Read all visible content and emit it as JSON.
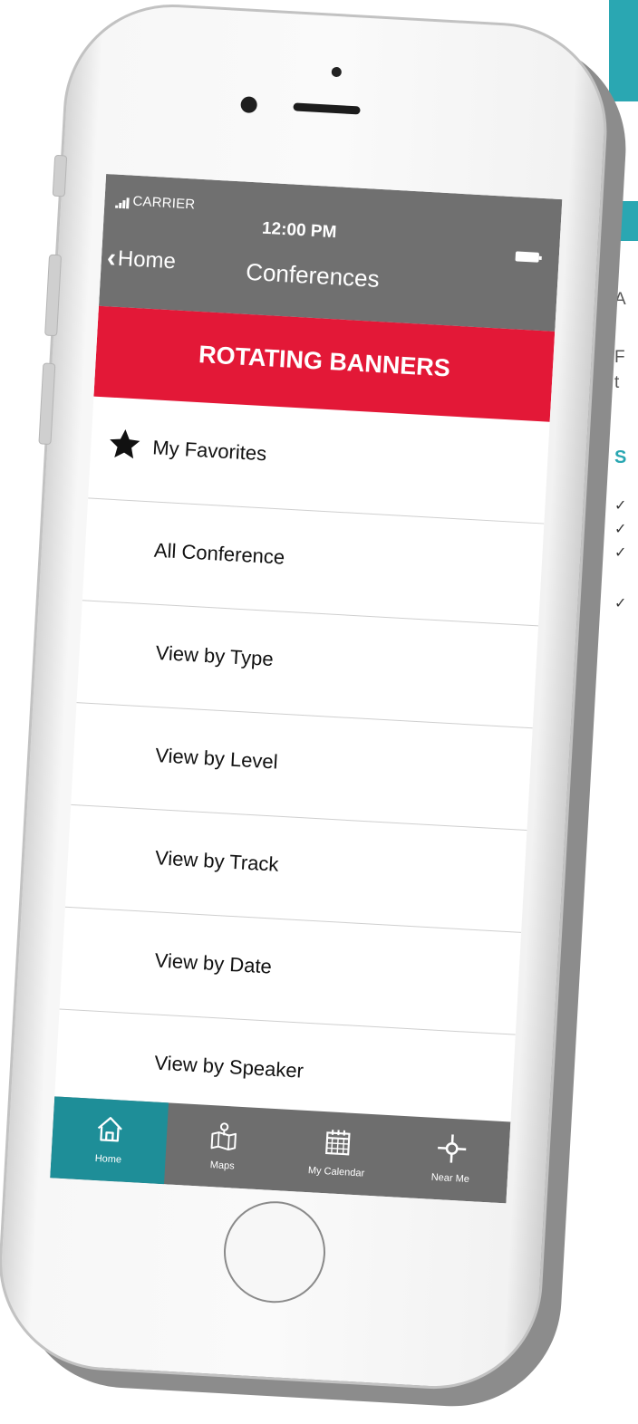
{
  "status_bar": {
    "carrier": "CARRIER",
    "time": "12:00 PM"
  },
  "nav": {
    "back_label": "Home",
    "title": "Conferences"
  },
  "banner": {
    "text": "ROTATING BANNERS",
    "color": "#e31837"
  },
  "menu": {
    "items": [
      {
        "label": "My Favorites",
        "icon": "star-icon"
      },
      {
        "label": "All Conference"
      },
      {
        "label": "View by Type"
      },
      {
        "label": "View by Level"
      },
      {
        "label": "View by Track"
      },
      {
        "label": "View by Date"
      },
      {
        "label": "View by Speaker"
      }
    ]
  },
  "tabbar": {
    "active_color": "#1e8e98",
    "bar_color": "#6e6e6e",
    "tabs": [
      {
        "label": "Home",
        "icon": "home-icon",
        "active": true
      },
      {
        "label": "Maps",
        "icon": "map-icon",
        "active": false
      },
      {
        "label": "My Calendar",
        "icon": "calendar-icon",
        "active": false
      },
      {
        "label": "Near Me",
        "icon": "location-crosshair-icon",
        "active": false
      }
    ]
  },
  "page_side": {
    "line1": "A",
    "line2a": "F",
    "line2b": "t",
    "subheading": "S",
    "checks": [
      "✓",
      "✓",
      "✓",
      "✓"
    ]
  }
}
